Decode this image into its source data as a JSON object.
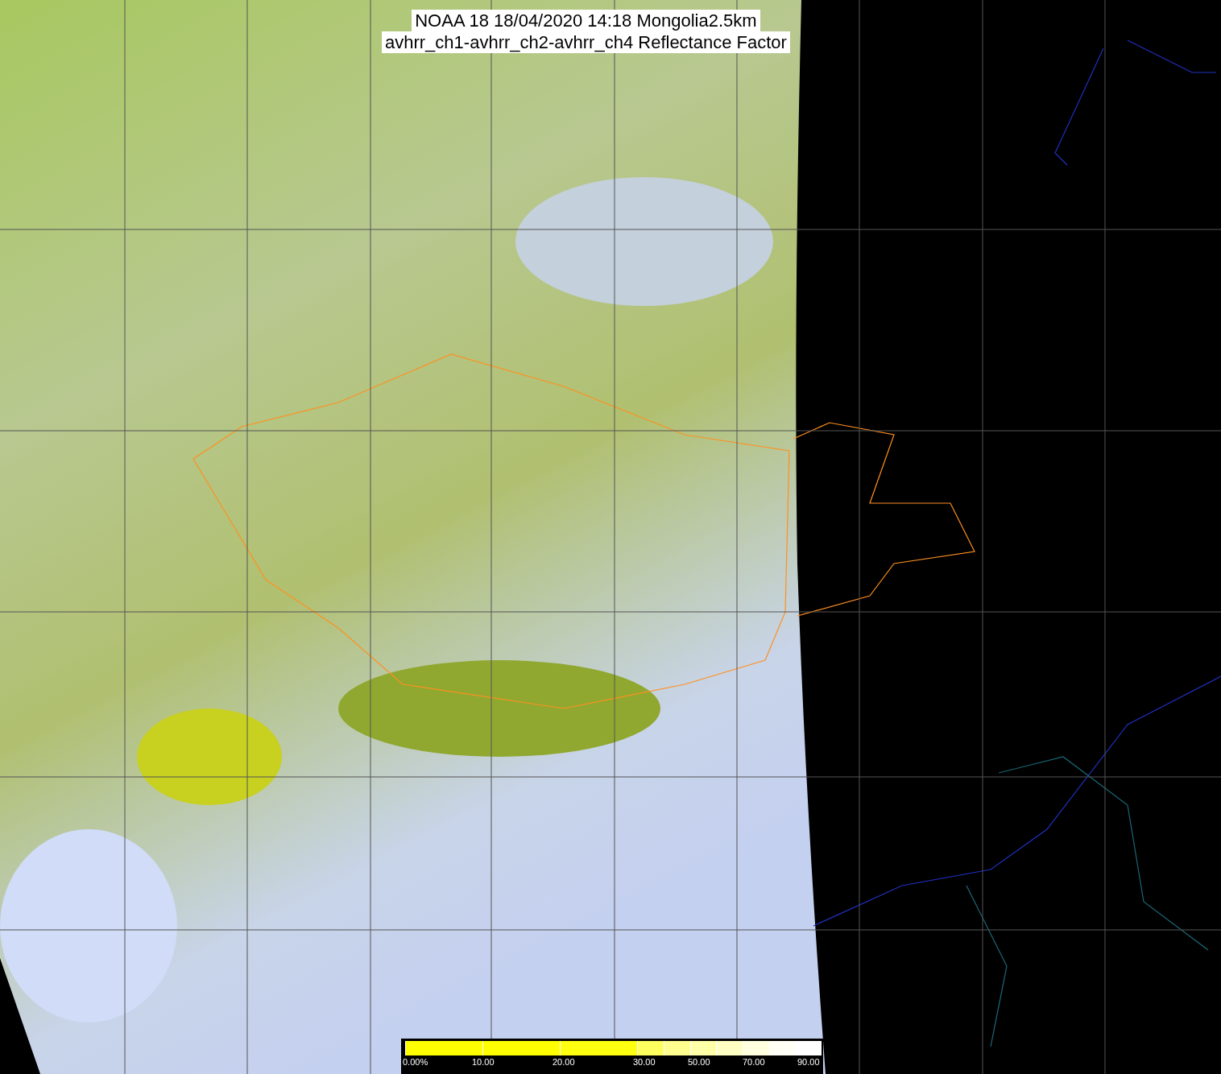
{
  "title": {
    "lines": [
      "NOAA 18 18/04/2020 14:18 Mongolia2.5km",
      "avhrr_ch1-avhrr_ch2-avhrr_ch4 Reflectance Factor"
    ]
  },
  "colorbar": {
    "segments": [
      {
        "color": "#ffff00",
        "label": "0.00%"
      },
      {
        "color": "#ffff00",
        "label": "10.00"
      },
      {
        "color": "#ffff10",
        "label": "20.00"
      },
      {
        "color": "#ffff60",
        "label": "30.00"
      },
      {
        "color": "#ffff90"
      },
      {
        "color": "#ffffa8",
        "label": "50.00"
      },
      {
        "color": "#ffffc4"
      },
      {
        "color": "#ffffe0",
        "label": "70.00"
      },
      {
        "color": "#fffff6"
      },
      {
        "color": "#ffffff",
        "label": "90.00"
      }
    ]
  }
}
